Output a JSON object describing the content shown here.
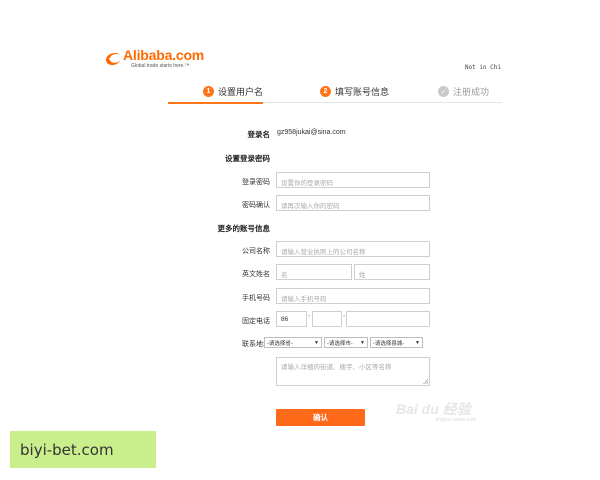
{
  "brand": {
    "name": "Alibaba",
    "suffix": ".com",
    "tagline": "Global trade starts here.™",
    "color": "#ff6a00"
  },
  "header": {
    "not_you": "Not in Chi"
  },
  "steps": [
    {
      "num": "1",
      "label": "设置用户名",
      "state": "active"
    },
    {
      "num": "2",
      "label": "填写账号信息",
      "state": "current"
    },
    {
      "num": "✓",
      "label": "注册成功",
      "state": "pending"
    }
  ],
  "form": {
    "login_name_label": "登录名",
    "login_name_value": "gz958jukai@sina.com",
    "password_section": "设置登录密码",
    "password_label": "登录密码",
    "password_placeholder": "设置你的登录密码",
    "confirm_label": "密码确认",
    "confirm_placeholder": "请再次输入你的密码",
    "more_section": "更多的账号信息",
    "company_label": "公司名称",
    "company_placeholder": "请输入营业执照上的公司名称",
    "english_name_label": "英文姓名",
    "first_name_placeholder": "名",
    "last_name_placeholder": "姓",
    "mobile_label": "手机号码",
    "mobile_placeholder": "请输入手机号码",
    "phone_label": "固定电话",
    "phone_country": "86",
    "phone_sep": "-",
    "address_label": "联系地址",
    "province": "-请选择省-",
    "city": "-请选择市-",
    "district": "-请选择县城-",
    "address_placeholder": "请输入详细的街道、楼宇、小区等名称",
    "submit": "确认"
  },
  "watermark": {
    "text": "Bai du 经验",
    "sub": "jingyan.baidu.com"
  },
  "ad": {
    "text": "biyi-bet.com"
  },
  "accent": "#ff7519"
}
